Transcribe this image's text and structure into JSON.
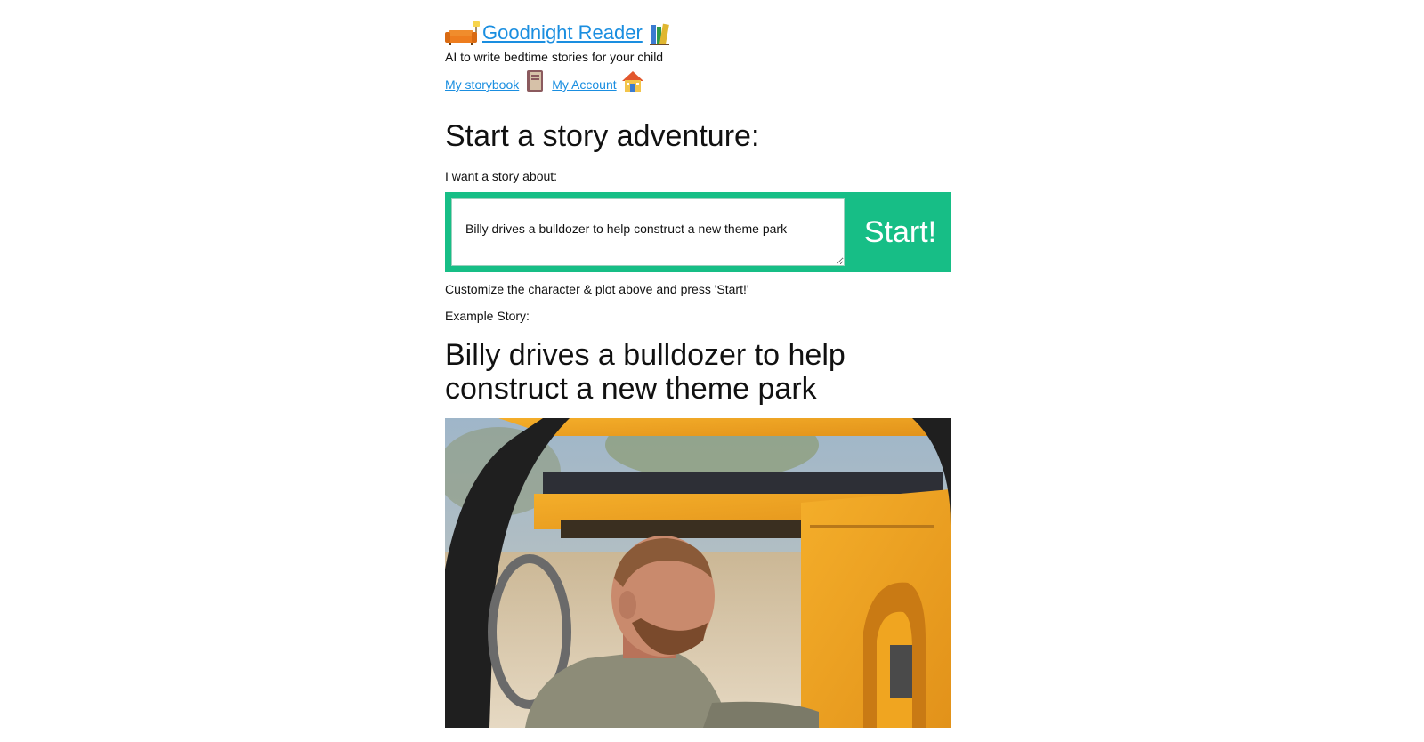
{
  "header": {
    "brand_name": "Goodnight Reader",
    "tagline": "AI to write bedtime stories for your child",
    "brand_icons": [
      "couch-lamp-icon",
      "books-icon"
    ]
  },
  "nav": {
    "items": [
      {
        "label": "My storybook ",
        "icon": "book-icon"
      },
      {
        "label": "My Account ",
        "icon": "house-icon"
      }
    ]
  },
  "main": {
    "heading": "Start a story adventure:",
    "prompt_label": "I want a story about:",
    "story_input_value": "Billy drives a bulldozer to help construct a new theme park",
    "start_button_label": "Start!",
    "hint": "Customize the character & plot above and press 'Start!'",
    "example_label": "Example Story:",
    "example_title": "Billy drives a bulldozer to help construct a new theme park"
  },
  "colors": {
    "accent_green": "#17be86",
    "link_blue": "#1a8ee0",
    "bulldozer_yellow": "#f0a21c"
  }
}
